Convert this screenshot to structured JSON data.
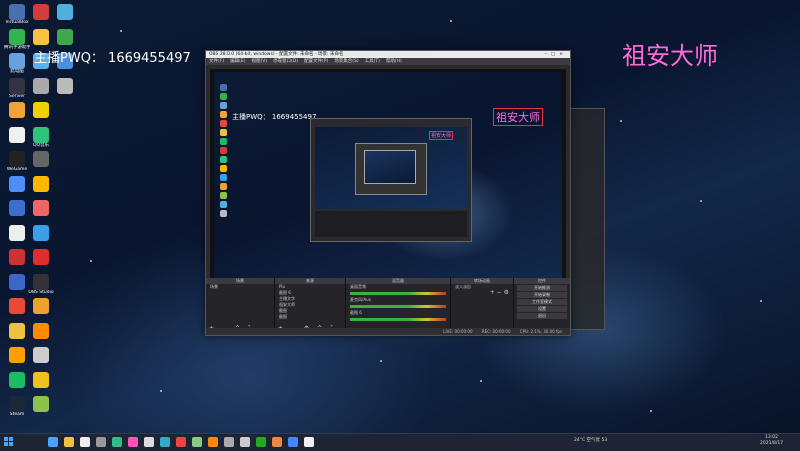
{
  "overlay": {
    "left_text": "主播PWQ： 1669455497",
    "right_text": "祖安大师"
  },
  "desktop_icons": [
    {
      "label": "VirtualBox",
      "color": "#4a6fb0"
    },
    {
      "label": "腾讯手游助手",
      "color": "#2fb54a"
    },
    {
      "label": "此电脑",
      "color": "#6aa0e0"
    },
    {
      "label": "Servier",
      "color": "#334"
    },
    {
      "label": "",
      "color": "#f2a23b"
    },
    {
      "label": "",
      "color": "#f0f0f0"
    },
    {
      "label": "WeGame",
      "color": "#222"
    },
    {
      "label": "",
      "color": "#4c8df6"
    },
    {
      "label": "",
      "color": "#3a6fd0"
    },
    {
      "label": "",
      "color": "#eee"
    },
    {
      "label": "",
      "color": "#cc3333"
    },
    {
      "label": "",
      "color": "#3c66c8"
    },
    {
      "label": "",
      "color": "#e94a35"
    },
    {
      "label": "",
      "color": "#f0c23b"
    },
    {
      "label": "",
      "color": "#ffa000"
    },
    {
      "label": "",
      "color": "#1ebc61"
    },
    {
      "label": "Steam",
      "color": "#1b2838"
    },
    {
      "label": "",
      "color": "#d23c3c"
    },
    {
      "label": "",
      "color": "#f5c242"
    },
    {
      "label": "",
      "color": "#5bb0f0"
    },
    {
      "label": "",
      "color": "#aaa"
    },
    {
      "label": "",
      "color": "#f0d000"
    },
    {
      "label": "QQ音乐",
      "color": "#31c27c"
    },
    {
      "label": "",
      "color": "#666"
    },
    {
      "label": "",
      "color": "#ffb800"
    },
    {
      "label": "",
      "color": "#e66"
    },
    {
      "label": "",
      "color": "#3aa0e8"
    },
    {
      "label": "",
      "color": "#dd2e2e"
    },
    {
      "label": "OBS Studio",
      "color": "#333"
    },
    {
      "label": "",
      "color": "#f0a030"
    },
    {
      "label": "",
      "color": "#ff8c00"
    },
    {
      "label": "",
      "color": "#ccc"
    },
    {
      "label": "",
      "color": "#f0c020"
    },
    {
      "label": "",
      "color": "#8bc34a"
    },
    {
      "label": "",
      "color": "#4fb0e0"
    },
    {
      "label": "",
      "color": "#3ea84a"
    },
    {
      "label": "",
      "color": "#4a8ee0"
    },
    {
      "label": "",
      "color": "#bbb"
    }
  ],
  "obs": {
    "title": "OBS 28.0.0 (64-bit, windows) - 配置文件: 未命名 - 场景: 未命名",
    "menu": [
      "文件(F)",
      "编辑(E)",
      "视图(V)",
      "停靠窗口(D)",
      "配置文件(P)",
      "场景集合(S)",
      "工具(T)",
      "帮助(H)"
    ],
    "docks": {
      "scenes": {
        "title": "场景",
        "items": [
          "场景"
        ]
      },
      "sources": {
        "title": "来源",
        "items": [
          "Plu",
          "截图 6",
          "主播文字",
          "祖安大师",
          "截图",
          "截图"
        ]
      },
      "mixer": {
        "title": "混音器",
        "tracks": [
          "桌面音频",
          "麦克风/Aux",
          "截图 6"
        ]
      },
      "transitions": {
        "title": "转场动画",
        "mode": "淡入淡出"
      },
      "controls": {
        "title": "控件",
        "buttons": [
          "开始推流",
          "开始录制",
          "工作室模式",
          "设置",
          "退出"
        ]
      }
    },
    "status": [
      "LIVE: 00:00:00",
      "REC: 00:00:00",
      "CPU: 2.1%, 30.00 fps"
    ]
  },
  "taskbar": {
    "items": [
      "#4aa3ff",
      "#f0c040",
      "#eee",
      "#999",
      "#3b8",
      "#f5b",
      "#ddd",
      "#3ac",
      "#e44",
      "#8c8",
      "#f80",
      "#aaa",
      "#ccc",
      "#2a2",
      "#e84",
      "#48f",
      "#f0f0f0"
    ],
    "tray": "24°C 空气优 53",
    "time": "13:02",
    "date": "2021/8/17"
  }
}
